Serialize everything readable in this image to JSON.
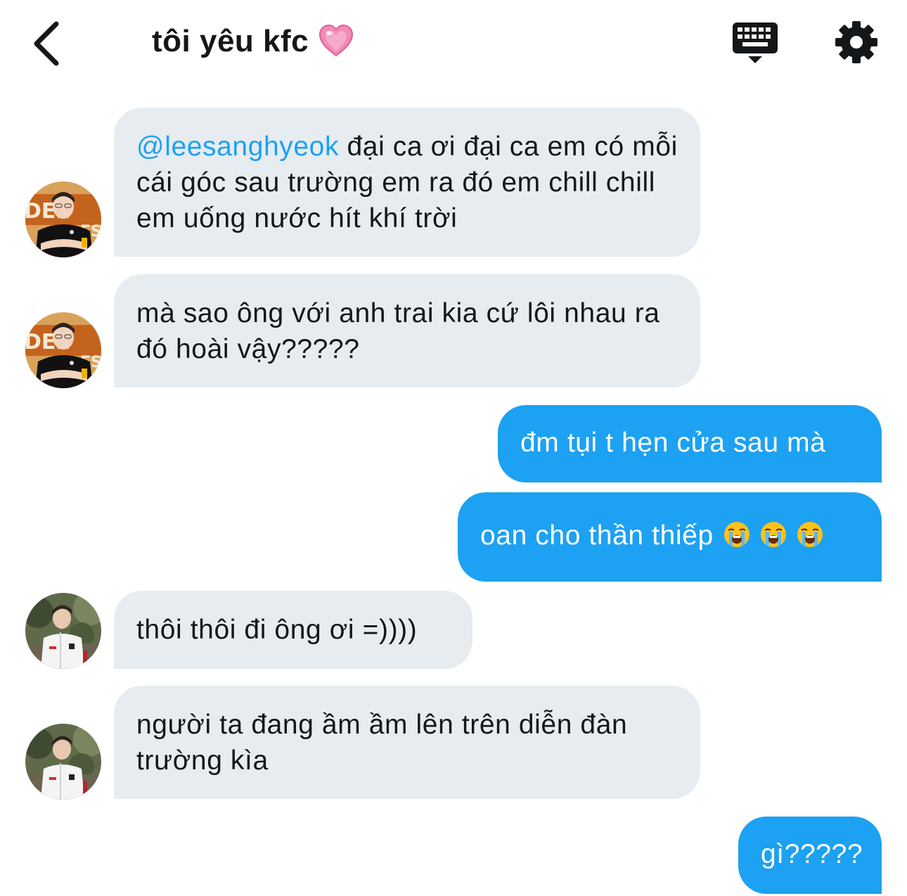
{
  "header": {
    "title": "tôi yêu kfc",
    "back_icon": "chevron-left-icon",
    "title_emoji": "pink-heart-emoji",
    "keyboard_icon": "keyboard-icon",
    "settings_icon": "gear-icon"
  },
  "colors": {
    "incoming_bubble": "#e6ecf0",
    "outgoing_bubble": "#1da1f2",
    "mention": "#1da1f2"
  },
  "messages": [
    {
      "direction": "incoming",
      "avatar": "avatar-player-black-jersey",
      "mention": "@leesanghyeok",
      "text": " đại ca ơi đại ca em có mỗi cái góc sau trường em ra đó em chill chill em uống nước hít khí trời"
    },
    {
      "direction": "incoming",
      "avatar": "avatar-player-black-jersey",
      "text": "mà sao ông với anh trai kia cứ lôi nhau ra đó hoài vậy?????"
    },
    {
      "direction": "outgoing",
      "text": "đm tụi t hẹn cửa sau mà"
    },
    {
      "direction": "outgoing",
      "text": "oan cho thần thiếp",
      "emojis": [
        "loudly-crying-face-emoji",
        "loudly-crying-face-emoji",
        "loudly-crying-face-emoji"
      ]
    },
    {
      "direction": "incoming",
      "avatar": "avatar-player-white-jacket",
      "text": "thôi thôi đi ông ơi =))))"
    },
    {
      "direction": "incoming",
      "avatar": "avatar-player-white-jacket",
      "text": "người ta đang ầm ầm lên trên diễn đàn trường kìa"
    },
    {
      "direction": "outgoing",
      "text": "gì?????"
    }
  ]
}
